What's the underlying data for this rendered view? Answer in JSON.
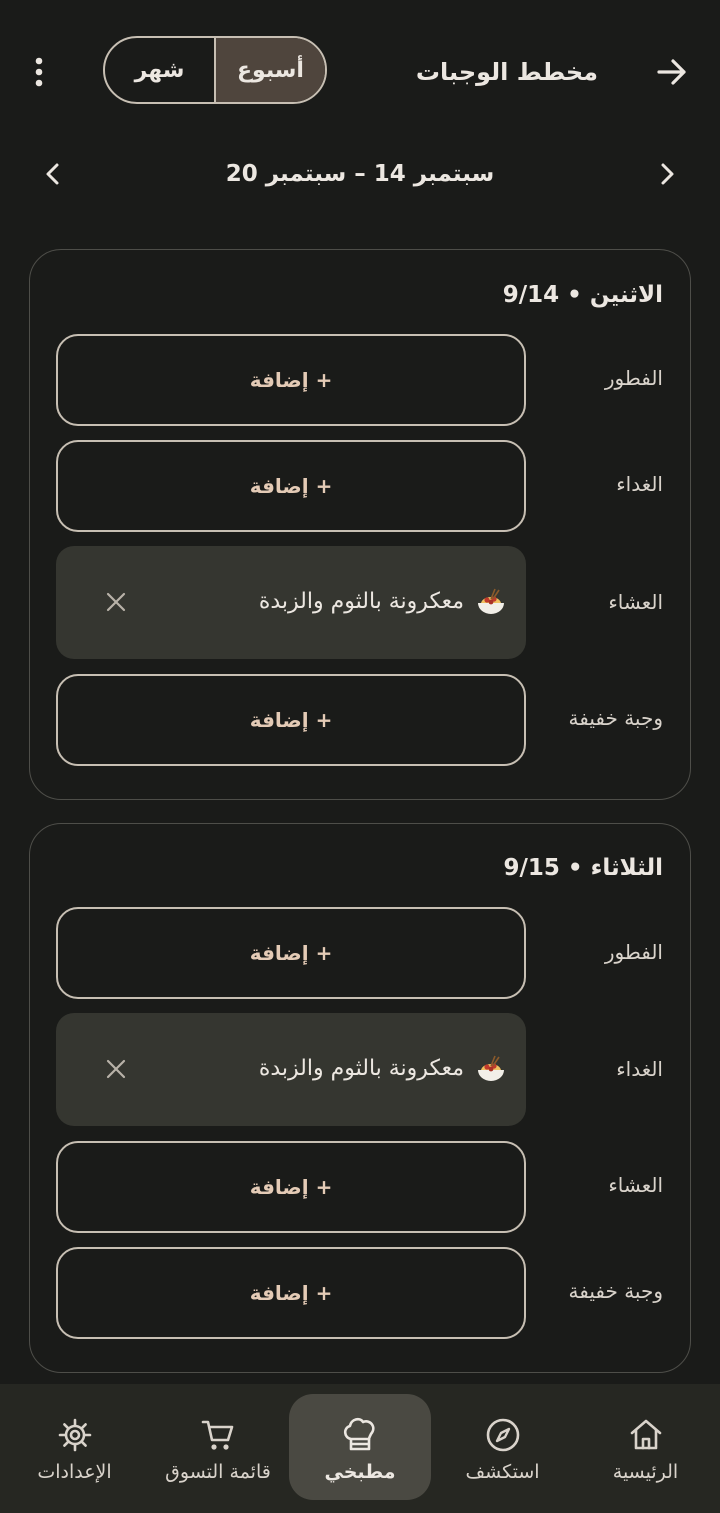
{
  "header": {
    "title": "مخطط الوجبات",
    "toggle": {
      "week": "أسبوع",
      "month": "شهر"
    }
  },
  "week_nav": {
    "range": "سبتمبر 14 – سبتمبر 20"
  },
  "days": [
    {
      "title": "الاثنين • 9/14",
      "meals": [
        {
          "label": "الفطور",
          "add_label": "+ إضافة"
        },
        {
          "label": "الغداء",
          "add_label": "+ إضافة"
        },
        {
          "label": "العشاء",
          "item_name": "معكرونة بالثوم والزبدة"
        },
        {
          "label": "وجبة خفيفة",
          "add_label": "+ إضافة"
        }
      ]
    },
    {
      "title": "الثلاثاء • 9/15",
      "meals": [
        {
          "label": "الفطور",
          "add_label": "+ إضافة"
        },
        {
          "label": "الغداء",
          "item_name": "معكرونة بالثوم والزبدة"
        },
        {
          "label": "العشاء",
          "add_label": "+ إضافة"
        },
        {
          "label": "وجبة خفيفة",
          "add_label": "+ إضافة"
        }
      ]
    }
  ],
  "bottom_nav": {
    "home": "الرئيسية",
    "explore": "استكشف",
    "kitchen": "مطبخي",
    "shopping": "قائمة التسوق",
    "settings": "الإعدادات"
  },
  "colors": {
    "background": "#1a1b19",
    "accent_text": "#e4cbb6",
    "active_segment": "#4f453d",
    "item_background": "#353630"
  }
}
